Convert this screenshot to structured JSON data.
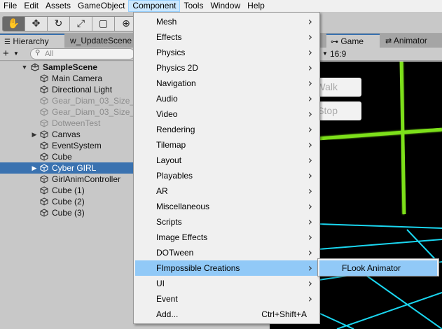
{
  "menubar": [
    "File",
    "Edit",
    "Assets",
    "GameObject",
    "Component",
    "Tools",
    "Window",
    "Help"
  ],
  "toolbar": {
    "tools": [
      "hand-tool",
      "move-tool",
      "rotate-tool",
      "scale-tool",
      "rect-tool",
      "transform-tool"
    ]
  },
  "hierarchy": {
    "tab_label": "Hierarchy",
    "second_tab_label": "w_UpdateScene",
    "search_placeholder": "All",
    "scene_name": "SampleScene",
    "items": [
      "Main Camera",
      "Directional Light",
      "Gear_Diam_03_Size_",
      "Gear_Diam_03_Size_",
      "DotweenTest",
      "Canvas",
      "EventSystem",
      "Cube",
      "Cyber GIRL",
      "GirlAnimController",
      "Cube (1)",
      "Cube (2)",
      "Cube (3)"
    ]
  },
  "game": {
    "tab_game": "Game",
    "tab_animator": "Animator",
    "aspect": "16:9",
    "btn_walk": "Walk",
    "btn_stop": "Stop"
  },
  "component_menu": {
    "items": [
      "Mesh",
      "Effects",
      "Physics",
      "Physics 2D",
      "Navigation",
      "Audio",
      "Video",
      "Rendering",
      "Tilemap",
      "Layout",
      "Playables",
      "AR",
      "Miscellaneous",
      "Scripts",
      "Image Effects",
      "DOTween",
      "FImpossible Creations",
      "UI",
      "Event",
      "Add..."
    ],
    "add_shortcut": "Ctrl+Shift+A",
    "highlighted": "FImpossible Creations"
  },
  "submenu": {
    "item": "FLook Animator"
  },
  "colors": {
    "selection": "#3a72b0",
    "menu_highlight": "#91c9f7",
    "neon_green": "#7de01a",
    "neon_cyan": "#1ad6f0"
  }
}
